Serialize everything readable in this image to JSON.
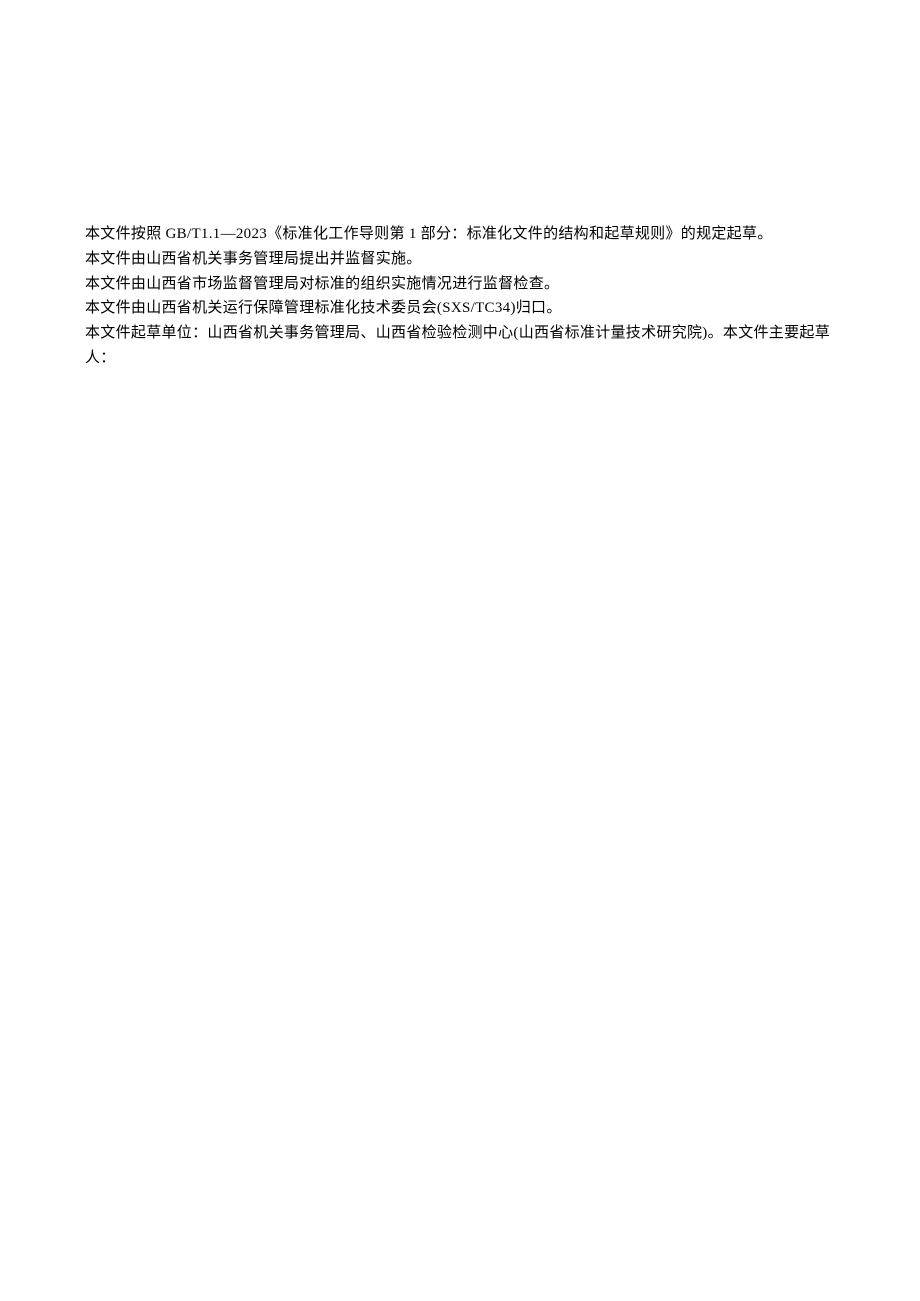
{
  "paragraphs": {
    "p1": "本文件按照 GB/T1.1—2023《标准化工作导则第 1 部分：标准化文件的结构和起草规则》的规定起草。",
    "p2": "本文件由山西省机关事务管理局提出并监督实施。",
    "p3": "本文件由山西省市场监督管理局对标准的组织实施情况进行监督检查。",
    "p4": "本文件由山西省机关运行保障管理标准化技术委员会(SXS/TC34)归口。",
    "p5": "本文件起草单位：山西省机关事务管理局、山西省检验检测中心(山西省标准计量技术研究院)。本文件主要起草人："
  }
}
